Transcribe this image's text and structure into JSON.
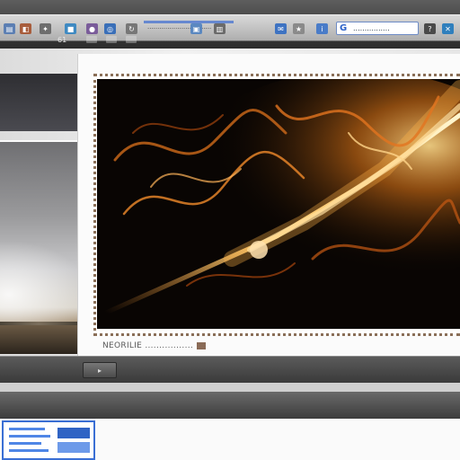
{
  "toolbar": {
    "icons": [
      "folder-icon",
      "image-icon",
      "gear-icon",
      "lock-icon",
      "person-icon",
      "search-icon",
      "refresh-icon",
      "copy-icon",
      "print-icon",
      "mail-icon",
      "star-icon",
      "info-icon",
      "help-icon",
      "close-icon"
    ],
    "status_label": "................................",
    "address_value": "................",
    "zoom_label": "61"
  },
  "viewer": {
    "caption": "NEORILIE ................."
  },
  "bottom": {
    "button_label": "▸"
  },
  "colors": {
    "accent": "#3b6bd1",
    "frame_border": "#8a6f58",
    "fire": "#ff8a1a",
    "background": "#090503"
  }
}
